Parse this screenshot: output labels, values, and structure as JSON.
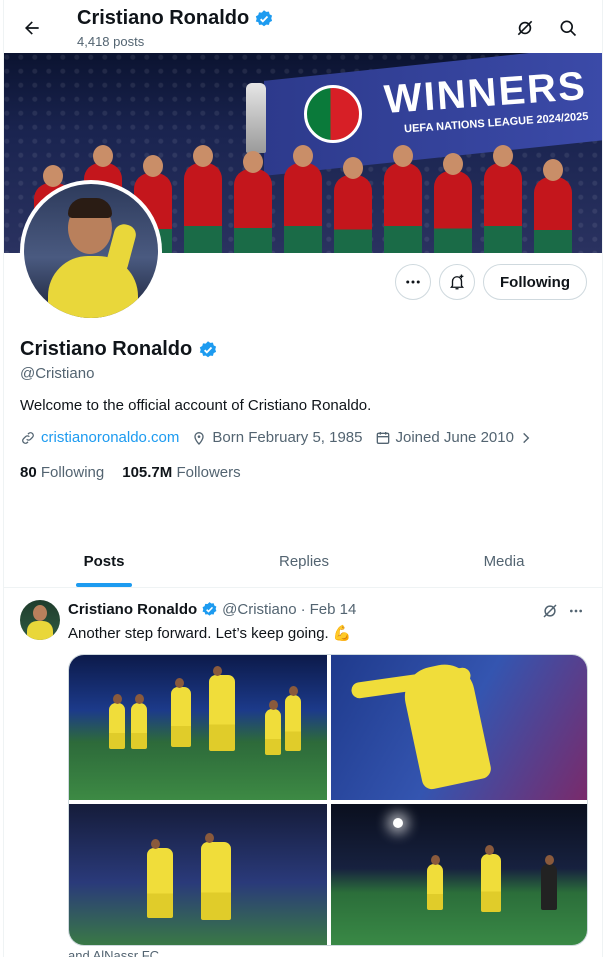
{
  "header": {
    "name": "Cristiano Ronaldo",
    "posts_count": "4,418 posts"
  },
  "banner": {
    "headline": "WINNERS",
    "subline": "UEFA NATIONS LEAGUE 2024/2025"
  },
  "profile": {
    "name": "Cristiano Ronaldo",
    "handle": "@Cristiano",
    "bio": "Welcome to the official account of Cristiano Ronaldo.",
    "website": "cristianoronaldo.com",
    "born": "Born February 5, 1985",
    "joined": "Joined June 2010",
    "following_count": "80",
    "following_label": "Following",
    "followers_count": "105.7M",
    "followers_label": "Followers"
  },
  "actions": {
    "following_button": "Following"
  },
  "tabs": [
    {
      "label": "Posts",
      "active": true
    },
    {
      "label": "Replies",
      "active": false
    },
    {
      "label": "Media",
      "active": false
    }
  ],
  "post": {
    "author": "Cristiano Ronaldo",
    "handle": "@Cristiano",
    "separator": "·",
    "date": "Feb 14",
    "text": "Another step forward. Let’s keep going.",
    "emoji": "💪",
    "footer_partial": "and AlNassr FC"
  },
  "colors": {
    "accent": "#1d9bf0",
    "text": "#0f1419",
    "muted": "#536471",
    "border": "#cfd9de"
  },
  "icons": [
    "back-arrow-icon",
    "verified-badge-icon",
    "grok-icon",
    "search-icon",
    "more-icon",
    "notification-bell-icon",
    "link-icon",
    "location-icon",
    "calendar-icon",
    "chevron-right-icon"
  ]
}
